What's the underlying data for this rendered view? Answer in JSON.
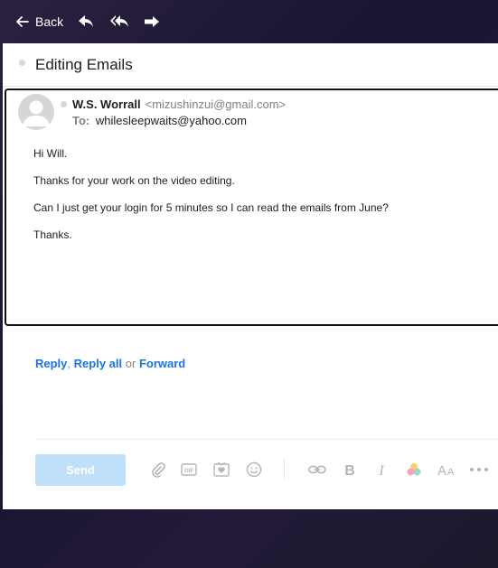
{
  "toolbar": {
    "back_label": "Back",
    "icons": [
      "back-arrow-icon",
      "reply-icon",
      "reply-all-icon",
      "forward-icon"
    ]
  },
  "subject": "Editing Emails",
  "message": {
    "from_name": "W.S. Worrall",
    "from_email": "<mizushinzui@gmail.com>",
    "to_label": "To:",
    "to_email": "whilesleepwaits@yahoo.com",
    "body": [
      "Hi Will.",
      "Thanks for your work on the video editing.",
      "Can I just get your login for 5 minutes so I can read the emails from June?",
      "Thanks."
    ]
  },
  "reply_row": {
    "reply": "Reply",
    "sep1": ",",
    "reply_all": "Reply all",
    "or": "or",
    "forward": "Forward"
  },
  "composer": {
    "send_label": "Send",
    "icons": [
      "attach-icon",
      "gif-icon",
      "sticker-icon",
      "emoji-icon",
      "link-icon",
      "bold-icon",
      "italic-icon",
      "color-icon",
      "font-size-icon",
      "more-icon"
    ]
  },
  "colors": {
    "accent": "#1a73e8",
    "send_disabled": "#bfe0fb",
    "background": "#1d1930"
  }
}
